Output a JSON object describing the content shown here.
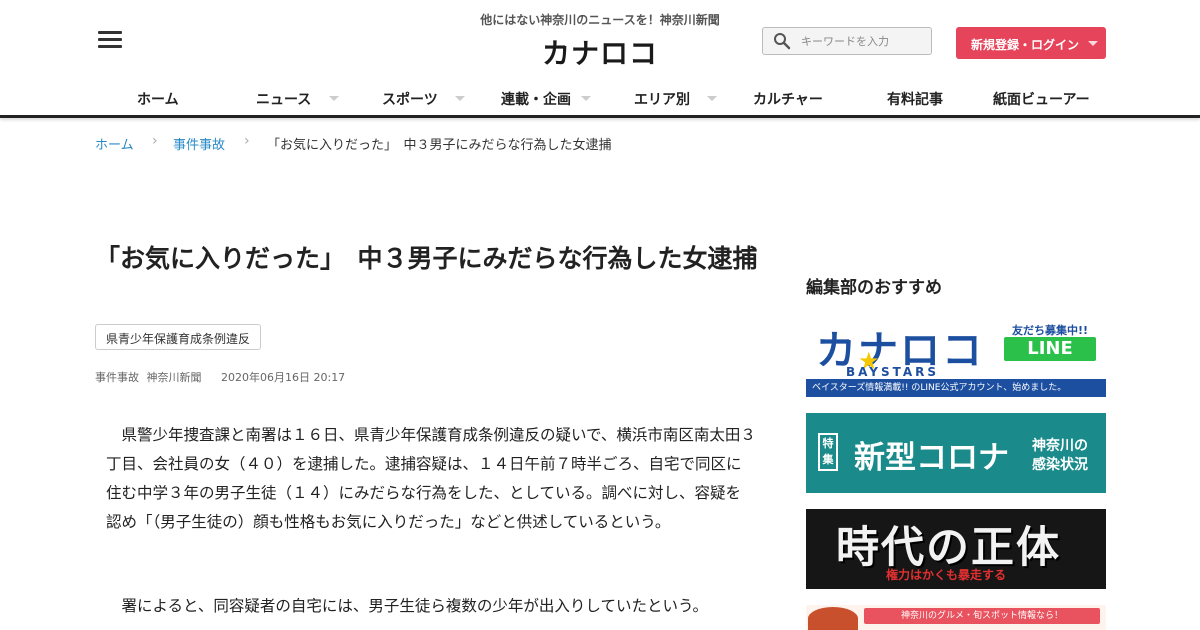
{
  "header": {
    "tagline": "他にはない神奈川のニュースを！神奈川新聞",
    "logo": "カナロコ",
    "search_placeholder": "キーワードを入力",
    "login_label": "新規登録・ログイン",
    "menu_icon": "hamburger-menu-icon"
  },
  "nav": {
    "items": [
      {
        "label": "ホーム",
        "has_dropdown": false
      },
      {
        "label": "ニュース",
        "has_dropdown": true
      },
      {
        "label": "スポーツ",
        "has_dropdown": true
      },
      {
        "label": "連載・企画",
        "has_dropdown": true
      },
      {
        "label": "エリア別",
        "has_dropdown": true
      },
      {
        "label": "カルチャー",
        "has_dropdown": false
      },
      {
        "label": "有料記事",
        "has_dropdown": false
      },
      {
        "label": "紙面ビューアー",
        "has_dropdown": false
      }
    ]
  },
  "breadcrumb": {
    "home": "ホーム",
    "category": "事件事故",
    "current": "「お気に入りだった」　中３男子にみだらな行為した女逮捕"
  },
  "article": {
    "title": "「お気に入りだった」　中３男子にみだらな行為した女逮捕",
    "tag": "県青少年保護育成条例違反",
    "meta_category": "事件事故",
    "meta_source": "神奈川新聞",
    "meta_date": "2020年06月16日 20:17",
    "paragraph1": "県警少年捜査課と南署は１６日、県青少年保護育成条例違反の疑いで、横浜市南区南太田３丁目、会社員の女（４０）を逮捕した。逮捕容疑は、１４日午前７時半ごろ、自宅で同区に住む中学３年の男子生徒（１４）にみだらな行為をした、としている。調べに対し、容疑を認め「（男子生徒の）顔も性格もお気に入りだった」などと供述しているという。",
    "paragraph2": "署によると、同容疑者の自宅には、男子生徒ら複数の少年が出入りしていたという。"
  },
  "sidebar": {
    "heading": "編集部のおすすめ",
    "banner_line": {
      "logo": "カナロコ",
      "badge": "友だち募集中!!",
      "line_label": "LINE",
      "sub": "BAYSTARS",
      "strip": "ベイスターズ情報満載!! のLINE公式アカウント、始めました。"
    },
    "banner_corona": {
      "toku": "特集",
      "main": "新型コロナ",
      "sub1": "神奈川の",
      "sub2": "感染状況"
    },
    "banner_jidai": {
      "main": "時代の正体",
      "sub": "権力はかくも暴走する"
    },
    "banner_gourmet": {
      "strip": "神奈川のグルメ・旬スポット情報なら！"
    }
  },
  "colors": {
    "accent_red": "#e5445a",
    "link_blue": "#2a8ac8",
    "line_green": "#2bc04a",
    "corona_teal": "#1a8a8a"
  }
}
